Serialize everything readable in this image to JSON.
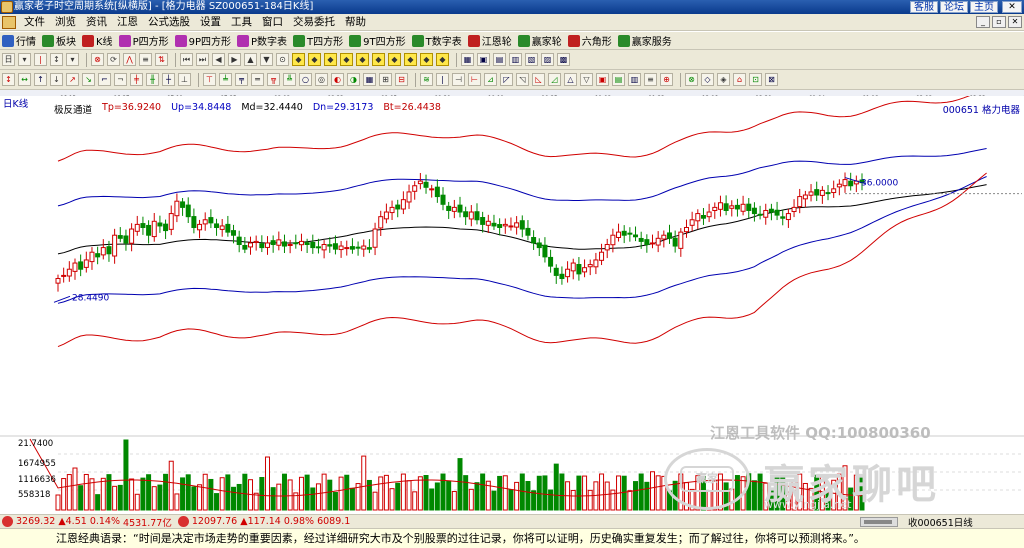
{
  "window": {
    "title": "赢家老子时空周期系统[纵横版] - [格力电器  SZ000651-184日K线]",
    "links": [
      "客服",
      "论坛",
      "主页"
    ]
  },
  "menu": [
    "文件",
    "浏览",
    "资讯",
    "江恩",
    "公式选股",
    "设置",
    "工具",
    "窗口",
    "交易委托",
    "帮助"
  ],
  "toolbar1": [
    {
      "label": "行情",
      "icon": "grid-icon",
      "color": "#3060c0"
    },
    {
      "label": "板块",
      "icon": "block-icon",
      "color": "#2a8a2a"
    },
    {
      "label": "K线",
      "icon": "candle-icon",
      "color": "#c02020"
    },
    {
      "label": "P四方形",
      "icon": "p-square-icon",
      "color": "#b030b0"
    },
    {
      "label": "9P四方形",
      "icon": "9p-square-icon",
      "color": "#b030b0"
    },
    {
      "label": "P数字表",
      "icon": "p-table-icon",
      "color": "#b030b0"
    },
    {
      "label": "T四方形",
      "icon": "t-square-icon",
      "color": "#2a8a2a"
    },
    {
      "label": "9T四方形",
      "icon": "9t-square-icon",
      "color": "#2a8a2a"
    },
    {
      "label": "T数字表",
      "icon": "t-table-icon",
      "color": "#2a8a2a"
    },
    {
      "label": "江恩轮",
      "icon": "gann-wheel-icon",
      "color": "#c02020"
    },
    {
      "label": "赢家轮",
      "icon": "winner-wheel-icon",
      "color": "#2a8a2a"
    },
    {
      "label": "六角形",
      "icon": "hexagon-icon",
      "color": "#c02020"
    },
    {
      "label": "赢家服务",
      "icon": "service-icon",
      "color": "#2a8a2a"
    }
  ],
  "chart": {
    "period_label": "日K线",
    "indicator_name": "极反通道",
    "indicators": [
      {
        "label": "Tp=36.9240",
        "color": "#c00000"
      },
      {
        "label": "Up=34.8448",
        "color": "#0000c0"
      },
      {
        "label": "Md=32.4440",
        "color": "#000000"
      },
      {
        "label": "Dn=29.3173",
        "color": "#0000c0"
      },
      {
        "label": "Bt=26.4438",
        "color": "#c00000"
      }
    ],
    "stock_tag": "000651  格力电器",
    "annotations": {
      "high": "36.0000",
      "low": "28.4490"
    },
    "date_ticks": [
      "06-13",
      "06-27",
      "07-11",
      "07-25",
      "08-08",
      "08-22",
      "09-05",
      "09-20",
      "10-11",
      "10-25",
      "11-08",
      "11-22",
      "12-06",
      "12-20",
      "01-04",
      "01-18",
      "02-08",
      "02-22",
      "03-08"
    ],
    "volume_scale": [
      "21.7400",
      "1674955",
      "1116636",
      "558318"
    ]
  },
  "watermark": {
    "line1": "江恩工具软件  QQ:100800360",
    "logo": "赢家",
    "big": "赢家聊吧",
    "site": "www.yingjia.net"
  },
  "status": {
    "sh_index": "3269.32",
    "sh_change": "▲4.51",
    "sh_pct": "0.14%",
    "sh_amount": "4531.77亿",
    "sz_index": "12097.76",
    "sz_change": "▲117.14",
    "sz_pct": "0.98%",
    "sz_amount": "6089.1",
    "right": "收000651日线"
  },
  "quote": "江恩经典语录：“时间是决定市场走势的重要因素，经过详细研究大市及个别股票的过往记录，你将可以证明，历史确实重复发生；而了解过往，你将可以预测将来。”。",
  "chart_data": {
    "type": "candlestick",
    "symbol": "000651",
    "name": "格力电器",
    "close": [
      29.6,
      29.8,
      30.2,
      30.6,
      30.2,
      30.8,
      31.3,
      31.0,
      31.6,
      31.2,
      32.4,
      32.2,
      31.9,
      32.8,
      33.1,
      32.9,
      32.4,
      33.3,
      33.0,
      32.7,
      33.8,
      34.6,
      34.2,
      33.6,
      32.9,
      33.1,
      33.4,
      33.2,
      32.9,
      33.0,
      32.6,
      32.4,
      31.8,
      31.5,
      31.9,
      32.0,
      31.6,
      31.9,
      31.8,
      32.1,
      31.7,
      31.8,
      31.9,
      32.0,
      31.8,
      31.6,
      31.6,
      31.8,
      31.7,
      31.5,
      31.7,
      31.6,
      31.5,
      31.6,
      31.7,
      31.5,
      32.8,
      33.6,
      33.9,
      34.2,
      34.1,
      34.7,
      35.2,
      35.6,
      35.9,
      35.5,
      35.4,
      34.9,
      34.4,
      34.0,
      34.2,
      33.9,
      33.6,
      33.9,
      33.4,
      33.1,
      33.3,
      33.0,
      32.9,
      33.1,
      33.0,
      33.2,
      32.8,
      32.4,
      31.9,
      31.6,
      31.0,
      30.4,
      29.8,
      29.6,
      30.2,
      30.6,
      29.9,
      30.3,
      30.5,
      30.8,
      31.3,
      31.8,
      32.4,
      32.6,
      32.4,
      32.5,
      32.3,
      32.0,
      31.8,
      31.9,
      32.2,
      32.4,
      32.2,
      31.7,
      32.6,
      32.9,
      33.4,
      33.8,
      33.5,
      33.9,
      34.2,
      34.5,
      34.0,
      34.3,
      34.1,
      34.4,
      34.0,
      33.8,
      33.7,
      34.0,
      33.9,
      33.7,
      33.5,
      33.8,
      34.2,
      34.9,
      35.0,
      35.2,
      35.0,
      35.3,
      35.1,
      35.4,
      35.7,
      36.0,
      35.6,
      35.9,
      35.8
    ],
    "upper_channel_Tp": 36.924,
    "upper_channel_Up": 34.8448,
    "mid_Md": 32.444,
    "lower_channel_Dn": 29.3173,
    "lower_channel_Bt": 26.4438,
    "high_mark": 36.0,
    "low_mark": 28.449
  }
}
